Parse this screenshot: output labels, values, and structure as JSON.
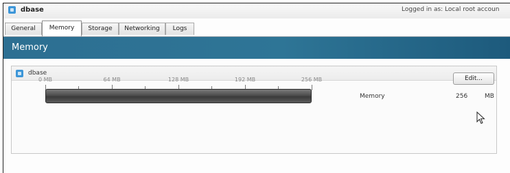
{
  "window": {
    "vm_name": "dbase",
    "logged_in_text": "Logged in as: Local root accoun"
  },
  "tabs": [
    {
      "label": "General",
      "active": false
    },
    {
      "label": "Memory",
      "active": true
    },
    {
      "label": "Storage",
      "active": false
    },
    {
      "label": "Networking",
      "active": false
    },
    {
      "label": "Logs",
      "active": false
    }
  ],
  "banner": {
    "title": "Memory"
  },
  "panel": {
    "vm_name": "dbase",
    "slider": {
      "ticks": [
        "0 MB",
        "64 MB",
        "128 MB",
        "192 MB",
        "256 MB"
      ],
      "level_fraction": 1.0
    },
    "memory_label": "Memory",
    "memory_value": "256",
    "memory_unit": "MB",
    "edit_label": "Edit..."
  },
  "colors": {
    "banner": "#2e7596",
    "vm_icon": "#3d96d8",
    "slider_fill": "#4d4d4d"
  },
  "icons": {
    "vm": "vm-icon",
    "pointer": "mouse-cursor-icon"
  }
}
